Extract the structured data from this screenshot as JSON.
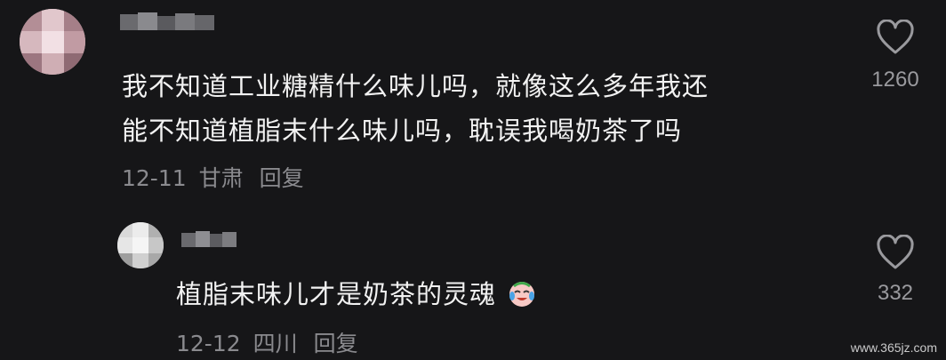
{
  "comments": [
    {
      "line1": "我不知道工业糖精什么味儿吗，就像这么多年我还",
      "line2": "能不知道植脂末什么味儿吗，耽误我喝奶茶了吗",
      "date": "12-11",
      "location": "甘肃",
      "reply_label": "回复",
      "likes": "1260"
    },
    {
      "text": "植脂末味儿才是奶茶的灵魂",
      "date": "12-12",
      "location": "四川",
      "reply_label": "回复",
      "likes": "332",
      "emoji": "crying-laughing-face"
    }
  ],
  "watermark": "www.365jz.com",
  "colors": {
    "background": "#161618",
    "text": "#f2f2f2",
    "muted": "#8a8a8e"
  },
  "icons": [
    "heart-outline-icon"
  ]
}
